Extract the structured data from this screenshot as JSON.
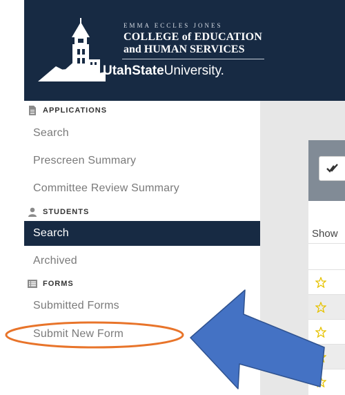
{
  "header": {
    "college_top": "EMMA ECCLES JONES",
    "college_line1": "COLLEGE of EDUCATION",
    "college_line2": "and HUMAN SERVICES",
    "university_bold": "UtahState",
    "university_light": "University."
  },
  "sidebar": {
    "applications": {
      "heading": "APPLICATIONS",
      "items": [
        "Search",
        "Prescreen Summary",
        "Committee Review Summary"
      ]
    },
    "students": {
      "heading": "STUDENTS",
      "items": [
        "Search",
        "Archived"
      ],
      "active_index": 0
    },
    "forms": {
      "heading": "FORMS",
      "items": [
        "Submitted Forms",
        "Submit New Form"
      ]
    }
  },
  "main": {
    "show_label": "Show"
  },
  "colors": {
    "navy": "#172a43",
    "annotation_circle": "#e8742a",
    "annotation_arrow": "#4472c4",
    "star": "#e6c200"
  }
}
